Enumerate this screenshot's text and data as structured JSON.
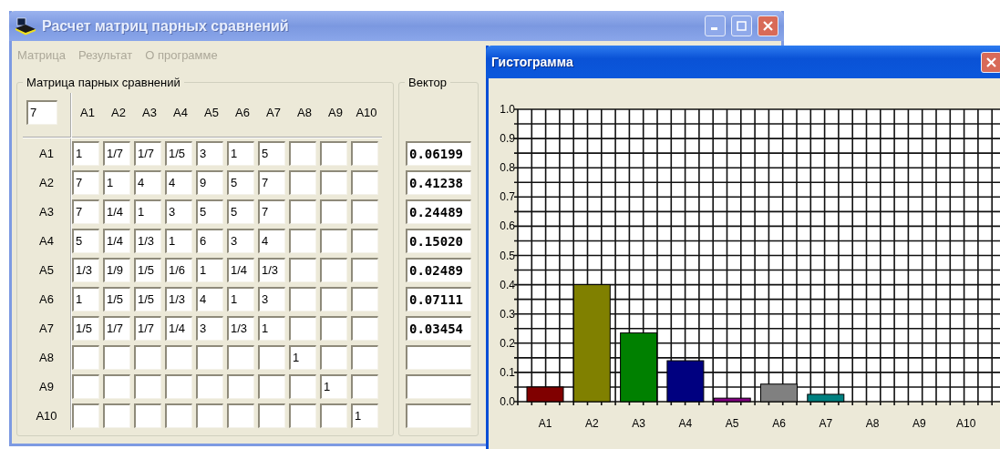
{
  "main_window": {
    "title": "Расчет матриц парных сравнений",
    "menu": [
      {
        "label": "Матрица",
        "disabled": true
      },
      {
        "label": "Результат",
        "disabled": true
      },
      {
        "label": "О программе",
        "disabled": true
      }
    ],
    "matrix_group": {
      "title": "Матрица парных сравнений",
      "size_value": "7",
      "column_headers": [
        "A1",
        "A2",
        "A3",
        "A4",
        "A5",
        "A6",
        "A7",
        "A8",
        "A9",
        "A10"
      ],
      "rows": [
        {
          "label": "A1",
          "cells": [
            "1",
            "1/7",
            "1/7",
            "1/5",
            "3",
            "1",
            "5",
            null,
            null,
            null
          ]
        },
        {
          "label": "A2",
          "cells": [
            "7",
            "1",
            "4",
            "4",
            "9",
            "5",
            "7",
            null,
            null,
            null
          ]
        },
        {
          "label": "A3",
          "cells": [
            "7",
            "1/4",
            "1",
            "3",
            "5",
            "5",
            "7",
            null,
            null,
            null
          ]
        },
        {
          "label": "A4",
          "cells": [
            "5",
            "1/4",
            "1/3",
            "1",
            "6",
            "3",
            "4",
            null,
            null,
            null
          ]
        },
        {
          "label": "A5",
          "cells": [
            "1/3",
            "1/9",
            "1/5",
            "1/6",
            "1",
            "1/4",
            "1/3",
            null,
            null,
            null
          ]
        },
        {
          "label": "A6",
          "cells": [
            "1",
            "1/5",
            "1/5",
            "1/3",
            "4",
            "1",
            "3",
            null,
            null,
            null
          ]
        },
        {
          "label": "A7",
          "cells": [
            "1/5",
            "1/7",
            "1/7",
            "1/4",
            "3",
            "1/3",
            "1",
            null,
            null,
            null
          ]
        },
        {
          "label": "A8",
          "cells": [
            null,
            null,
            null,
            null,
            null,
            null,
            null,
            "1",
            null,
            null
          ]
        },
        {
          "label": "A9",
          "cells": [
            null,
            null,
            null,
            null,
            null,
            null,
            null,
            null,
            "1",
            null
          ]
        },
        {
          "label": "A10",
          "cells": [
            null,
            null,
            null,
            null,
            null,
            null,
            null,
            null,
            null,
            "1"
          ]
        }
      ]
    },
    "vector_group": {
      "title": "Вектор",
      "values": [
        "0.06199",
        "0.41238",
        "0.24489",
        "0.15020",
        "0.02489",
        "0.07111",
        "0.03454"
      ]
    }
  },
  "histogram_window": {
    "title": "Гистограмма",
    "chart_data": {
      "type": "bar",
      "grid": true,
      "categories": [
        "A1",
        "A2",
        "A3",
        "A4",
        "A5",
        "A6",
        "A7",
        "A8",
        "A9",
        "A10"
      ],
      "values": [
        0.05,
        0.4,
        0.235,
        0.14,
        0.012,
        0.06,
        0.025,
        null,
        null,
        null
      ],
      "colors": [
        "#800000",
        "#808000",
        "#008000",
        "#000080",
        "#800080",
        "#808080",
        "#008080",
        null,
        null,
        null
      ],
      "ylim": [
        0,
        1
      ],
      "yticks": [
        {
          "value": 0,
          "label": "0.0"
        },
        {
          "value": 0.1,
          "label": "0.1"
        },
        {
          "value": 0.2,
          "label": "0.2"
        },
        {
          "value": 0.3,
          "label": "0.3"
        },
        {
          "value": 0.4,
          "label": "0.4"
        },
        {
          "value": 0.5,
          "label": "0.5"
        },
        {
          "value": 0.6,
          "label": "0.6"
        },
        {
          "value": 0.7,
          "label": "0.7"
        },
        {
          "value": 0.8,
          "label": "0.8"
        },
        {
          "value": 0.9,
          "label": "0.9"
        },
        {
          "value": 1,
          "label": "1.0"
        }
      ]
    }
  }
}
